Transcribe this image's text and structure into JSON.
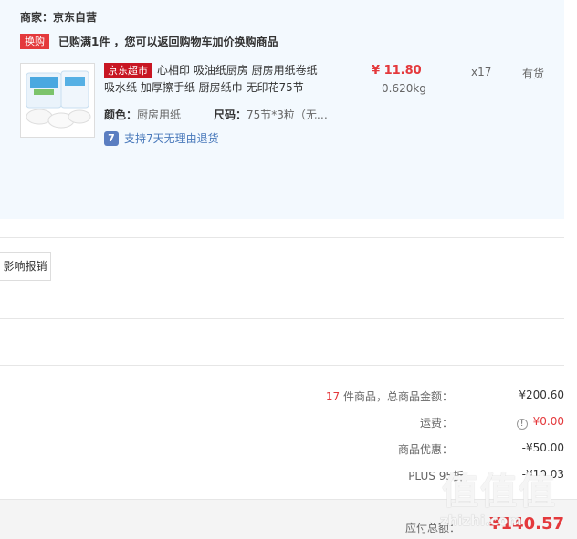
{
  "order": {
    "vendor": "商家：京东自营",
    "promo_tag": "换购",
    "promo_text": "已购满1件 ，您可以返回购物车加价换购商品"
  },
  "product": {
    "market_tag": "京东超市",
    "title": "心相印 吸油纸厨房 厨房用纸卷纸吸水纸 加厚擦手纸 厨房纸巾 无印花75节",
    "color_label": "颜色：",
    "color_value": "厨房用纸",
    "size_label": "尺码：",
    "size_value": "75节*3粒（无…",
    "return_icon": "7",
    "return_text": "支持7天无理由退货",
    "price": "¥ 11.80",
    "weight": "0.620kg",
    "qty": "x17",
    "stock": "有货"
  },
  "invoice": {
    "button": "影响报销"
  },
  "summary": {
    "count": "17",
    "items_label": " 件商品，总商品金额：",
    "items_value": "¥200.60",
    "shipping_label": "运费：",
    "shipping_icon": "!",
    "shipping_value": "¥0.00",
    "discount_label": "商品优惠：",
    "discount_value": "-¥50.00",
    "plus_label": "PLUS 95折",
    "plus_value": "-¥10.03"
  },
  "total": {
    "label": "应付总额：",
    "value": "¥140.57"
  },
  "watermark": {
    "text": "值值值",
    "url": "zhizhi.com"
  }
}
